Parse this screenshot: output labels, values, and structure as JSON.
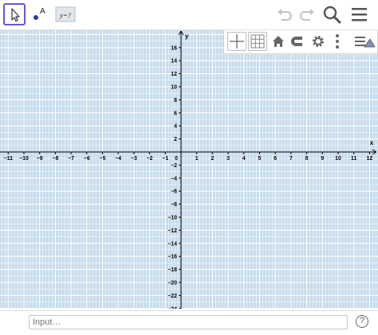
{
  "toolbar": {
    "tools": [
      {
        "name": "move-tool",
        "icon": "cursor-arrow-icon"
      },
      {
        "name": "point-tool",
        "icon": "point-icon",
        "label": "A"
      },
      {
        "name": "input-tool",
        "icon": "equation-icon",
        "label": "y=?"
      }
    ],
    "right_icons": [
      "undo-icon",
      "redo-icon",
      "search-icon",
      "menu-icon"
    ]
  },
  "style_bar": {
    "buttons": [
      "axes-icon",
      "grid-icon",
      "home-icon",
      "magnet-icon",
      "gear-icon",
      "more-icon",
      "algebra-toggle-icon"
    ]
  },
  "graph": {
    "x_axis_label": "x",
    "y_axis_label": "y",
    "x_min": -11,
    "x_max": 12,
    "y_min": -24,
    "y_max": 16,
    "x_tick_step": 1,
    "y_tick_step": 2,
    "grid": true,
    "origin_label": "0",
    "colors": {
      "background": "#c7dcec",
      "grid": "#ffffff",
      "axis": "#000000"
    }
  },
  "input_bar": {
    "placeholder": "Input…",
    "help_label": "?"
  }
}
